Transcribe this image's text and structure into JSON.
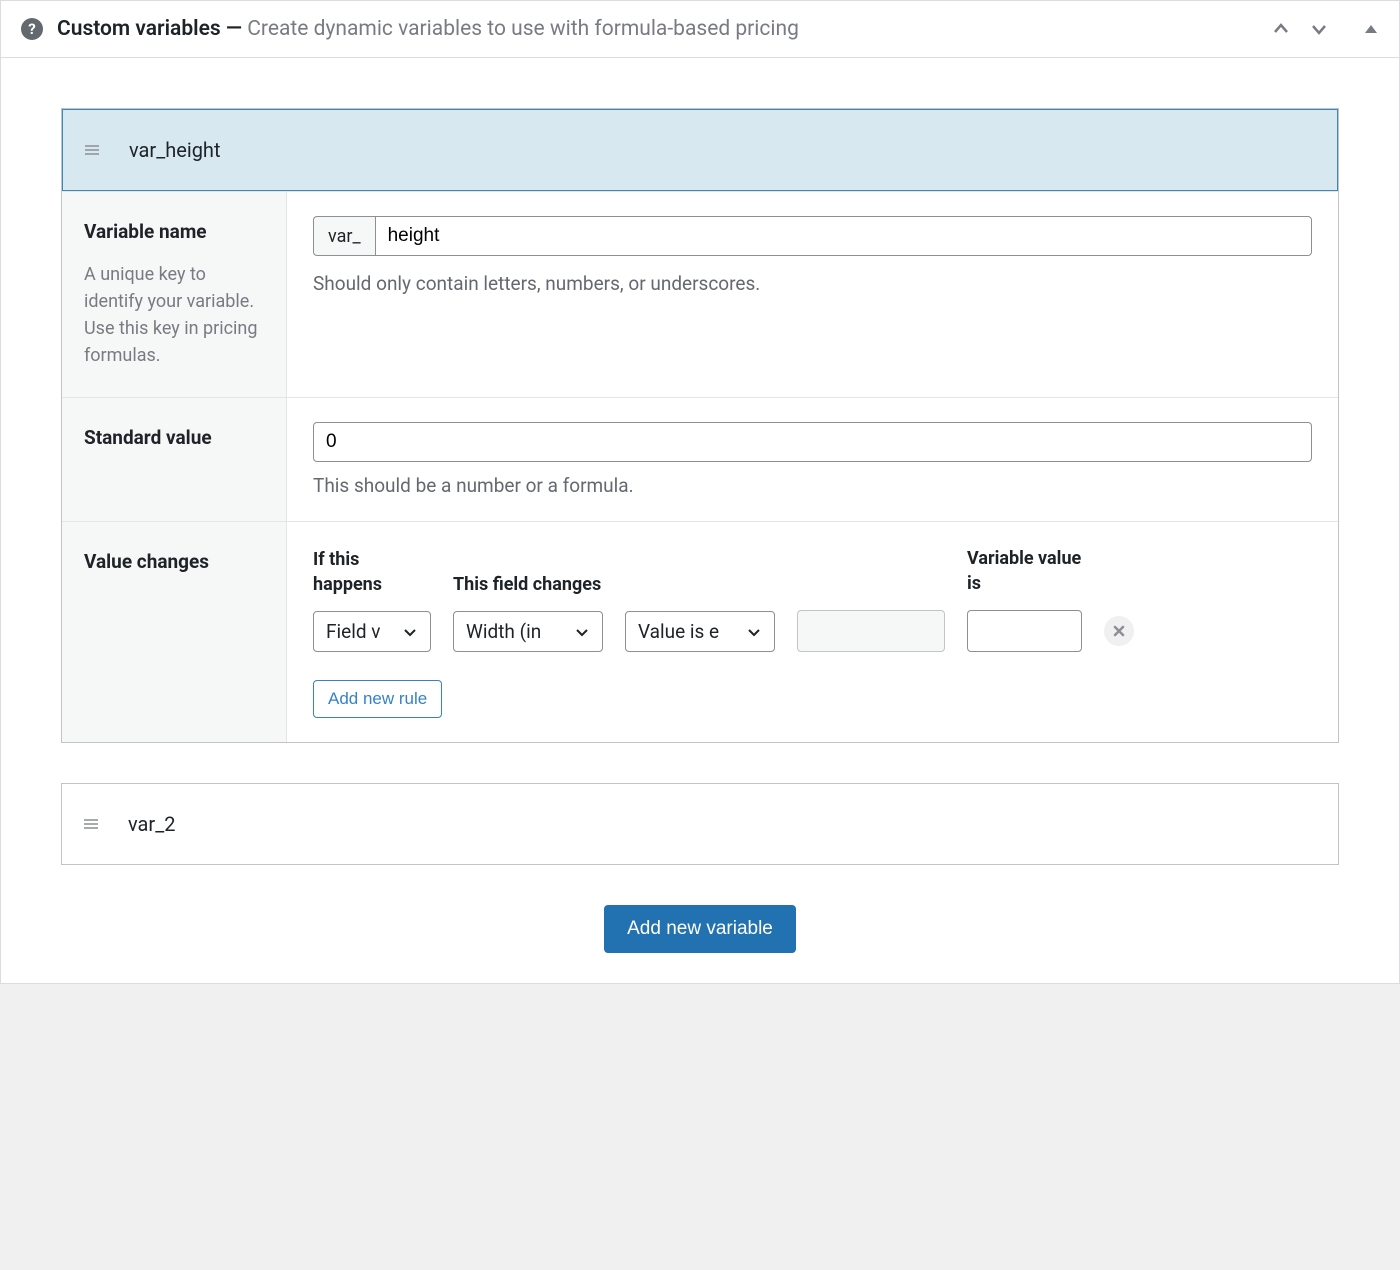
{
  "header": {
    "title": "Custom variables",
    "separator": " — ",
    "subtitle": "Create dynamic variables to use with formula-based pricing"
  },
  "variables": [
    {
      "display_name": "var_height",
      "name_field": {
        "label": "Variable name",
        "desc": "A unique key to identify your variable. Use this key in pricing formulas.",
        "prefix": "var_",
        "value": "height",
        "help": "Should only contain letters, numbers, or underscores."
      },
      "standard_value": {
        "label": "Standard value",
        "value": "0",
        "help": "This should be a number or a formula."
      },
      "value_changes": {
        "label": "Value changes",
        "columns": {
          "c1": "If this happens",
          "c2": "This field changes",
          "c5": "Variable value is"
        },
        "rule": {
          "condition": "Field v",
          "field": "Width (in",
          "operator": "Value is e",
          "comparison": "",
          "result": ""
        },
        "add_rule_label": "Add new rule"
      }
    },
    {
      "display_name": "var_2"
    }
  ],
  "add_variable_label": "Add new variable"
}
